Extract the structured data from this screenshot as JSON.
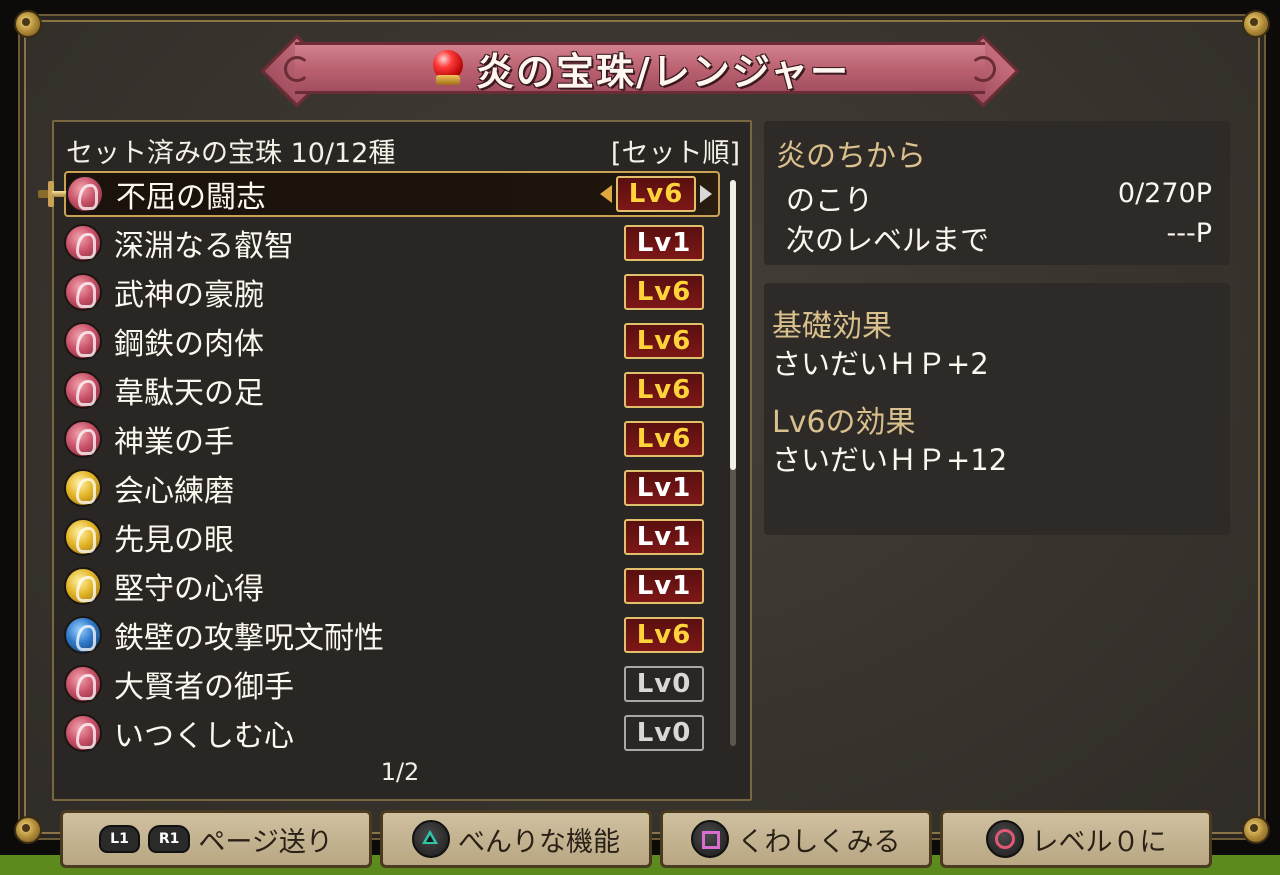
{
  "title": "炎の宝珠/レンジャー",
  "list": {
    "header_left": "セット済みの宝珠 10/12種",
    "header_right": "[セット順]",
    "page": "1/2",
    "scroll_position": 0,
    "items": [
      {
        "name": "不屈の闘志",
        "gem": "red",
        "level": "Lv6",
        "level_style": "gold",
        "selected": true
      },
      {
        "name": "深淵なる叡智",
        "gem": "red",
        "level": "Lv1",
        "level_style": "white"
      },
      {
        "name": "武神の豪腕",
        "gem": "red",
        "level": "Lv6",
        "level_style": "gold"
      },
      {
        "name": "鋼鉄の肉体",
        "gem": "red",
        "level": "Lv6",
        "level_style": "gold"
      },
      {
        "name": "韋駄天の足",
        "gem": "red",
        "level": "Lv6",
        "level_style": "gold"
      },
      {
        "name": "神業の手",
        "gem": "red",
        "level": "Lv6",
        "level_style": "gold"
      },
      {
        "name": "会心練磨",
        "gem": "yellow",
        "level": "Lv1",
        "level_style": "white"
      },
      {
        "name": "先見の眼",
        "gem": "yellow",
        "level": "Lv1",
        "level_style": "white"
      },
      {
        "name": "堅守の心得",
        "gem": "yellow",
        "level": "Lv1",
        "level_style": "white"
      },
      {
        "name": "鉄壁の攻撃呪文耐性",
        "gem": "blue",
        "level": "Lv6",
        "level_style": "gold"
      },
      {
        "name": "大賢者の御手",
        "gem": "red",
        "level": "Lv0",
        "level_style": "grey"
      },
      {
        "name": "いつくしむ心",
        "gem": "red",
        "level": "Lv0",
        "level_style": "grey"
      }
    ]
  },
  "info": {
    "title": "炎のちから",
    "remaining_label": "のこり",
    "remaining_value": "0/270P",
    "next_label": "次のレベルまで",
    "next_value": "---P"
  },
  "effects": {
    "base_title": "基礎効果",
    "base_value": "さいだいＨＰ+2",
    "level_title": "Lv6の効果",
    "level_value": "さいだいＨＰ+12"
  },
  "buttons": {
    "page_l1": "L1",
    "page_r1": "R1",
    "page_label": "ページ送り",
    "convenient_label": "べんりな機能",
    "detail_label": "くわしくみる",
    "level_zero_label": "レベル０に"
  },
  "colors": {
    "title_ribbon": "#b9606f",
    "level_gold": "#ffd43b",
    "accent_gold": "#c8a255",
    "panel_title": "#d9c08c"
  }
}
